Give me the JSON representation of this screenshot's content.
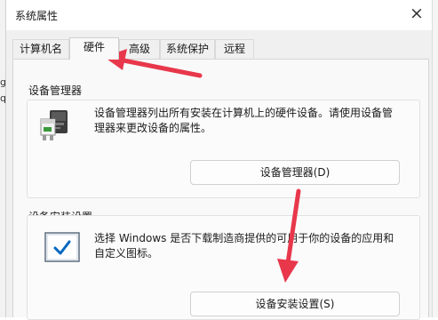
{
  "window": {
    "title": "系统属性",
    "close_glyph": "×"
  },
  "left_sliver_text": [
    "g",
    "q"
  ],
  "tabs": [
    {
      "label": "计算机名"
    },
    {
      "label": "硬件"
    },
    {
      "label": "高级"
    },
    {
      "label": "系统保护"
    },
    {
      "label": "远程"
    }
  ],
  "active_tab": "硬件",
  "device_manager": {
    "group_label": "设备管理器",
    "description_line1": "设备管理器列出所有安装在计算机上的硬件设备。请使用设备管",
    "description_line2": "理器来更改设备的属性。",
    "button_label": "设备管理器(D)",
    "icon": "device-manager-icon"
  },
  "device_install": {
    "group_label": "设备安装设置",
    "description_line1": "选择 Windows 是否下载制造商提供的可用于你的设备的应用和",
    "description_line2": "自定义图标。",
    "button_label": "设备安装设置(S)",
    "icon": "checkbox-monitor-icon"
  },
  "annotation_color": "#e8374b",
  "colors": {
    "accent": "#0067c0",
    "dialog_bg": "#f0f0f0",
    "panel_bg": "#f9f9f9"
  }
}
